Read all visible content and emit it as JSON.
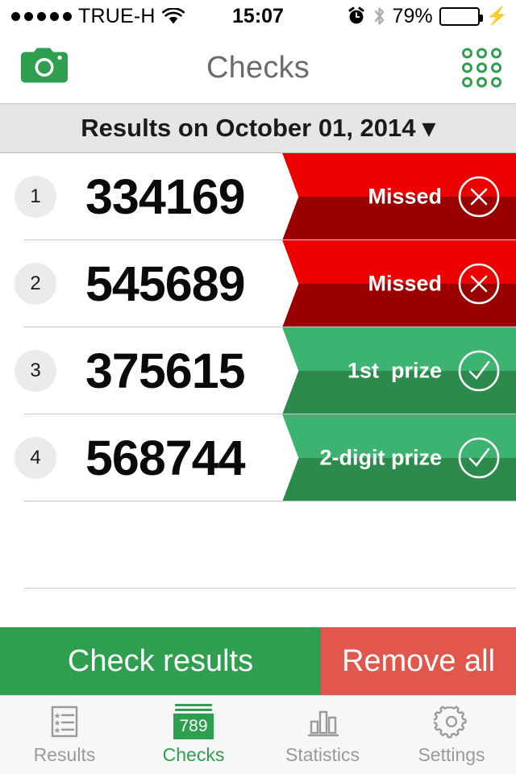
{
  "status_bar": {
    "signal_dots": 5,
    "carrier": "TRUE-H",
    "wifi_icon": "wifi-icon",
    "time": "15:07",
    "alarm_icon": "alarm-clock-icon",
    "bluetooth_icon": "bluetooth-icon",
    "battery_percent": "79%",
    "battery_level": 79,
    "charging_icon": "lightning-bolt-icon"
  },
  "nav_bar": {
    "title": "Checks",
    "left_icon": "camera-icon",
    "right_icon": "grid-dots-icon"
  },
  "section_header": {
    "text": "Results on October 01, 2014 ▾"
  },
  "colors": {
    "brand_green": "#2e9e4f",
    "green_light": "#3cb371",
    "green_dark": "#2b8a4c",
    "red_bright": "#ee0000",
    "red_dark": "#9b0000",
    "remove_red": "#e2574c",
    "header_gray": "#e6e6e6",
    "tab_inactive": "#9a9a9a"
  },
  "rows": [
    {
      "index": "1",
      "number": "334169",
      "status_label": "Missed",
      "status_icon": "circle-x-icon",
      "color_top": "#ee0000",
      "color_bottom": "#9b0000"
    },
    {
      "index": "2",
      "number": "545689",
      "status_label": "Missed",
      "status_icon": "circle-x-icon",
      "color_top": "#ee0000",
      "color_bottom": "#9b0000"
    },
    {
      "index": "3",
      "number": "375615",
      "status_label": "1st  prize",
      "status_icon": "circle-check-icon",
      "color_top": "#3cb371",
      "color_bottom": "#2b8a4c"
    },
    {
      "index": "4",
      "number": "568744",
      "status_label": "2-digit prize",
      "status_icon": "circle-check-icon",
      "color_top": "#3cb371",
      "color_bottom": "#2b8a4c"
    }
  ],
  "actions": {
    "check_label": "Check results",
    "remove_label": "Remove all"
  },
  "tabs": [
    {
      "label": "Results",
      "icon": "list-document-icon",
      "active": false
    },
    {
      "label": "Checks",
      "icon": "checks-stack-icon",
      "active": true,
      "badge": "789"
    },
    {
      "label": "Statistics",
      "icon": "bar-chart-icon",
      "active": false
    },
    {
      "label": "Settings",
      "icon": "gear-icon",
      "active": false
    }
  ]
}
